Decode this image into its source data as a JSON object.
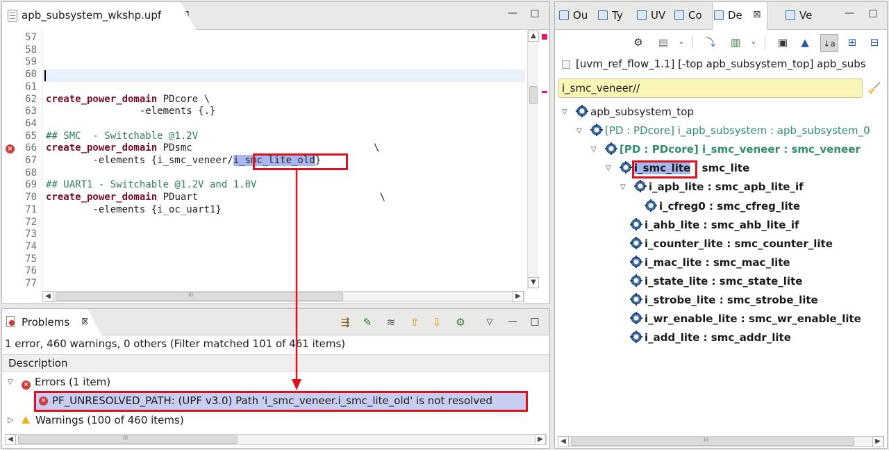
{
  "editor": {
    "tab_title": "apb_subsystem_wkshp.upf",
    "close_glyph": "⊠",
    "minimize_glyph": "—",
    "maximize_glyph": "□",
    "lines": [
      {
        "num": "57",
        "text": ""
      },
      {
        "num": "58",
        "text": ""
      },
      {
        "num": "59",
        "text": ""
      },
      {
        "num": "60",
        "text": ""
      },
      {
        "num": "61",
        "text": ""
      },
      {
        "num": "62",
        "kw": "create_power_domain",
        "rest": " PDcore \\"
      },
      {
        "num": "63",
        "text": "                -elements {.}"
      },
      {
        "num": "64",
        "text": ""
      },
      {
        "num": "65",
        "comment": "## SMC  - Switchable @1.2V"
      },
      {
        "num": "66",
        "kw": "create_power_domain",
        "rest": " PDsmc                               \\"
      },
      {
        "num": "67",
        "text": "        -elements {i_smc_veneer/",
        "highlight": "i_smc_lite_old",
        "tail": "}"
      },
      {
        "num": "68",
        "text": ""
      },
      {
        "num": "69",
        "comment": "## UART1 - Switchable @1.2V and 1.0V"
      },
      {
        "num": "70",
        "kw": "create_power_domain",
        "rest": " PDuart                               \\"
      },
      {
        "num": "71",
        "text": "        -elements {i_oc_uart1}"
      },
      {
        "num": "72",
        "text": ""
      },
      {
        "num": "73",
        "text": ""
      },
      {
        "num": "74",
        "text": ""
      },
      {
        "num": "75",
        "text": ""
      },
      {
        "num": "76",
        "text": ""
      },
      {
        "num": "77",
        "text": ""
      }
    ],
    "hscroll_grip": "III"
  },
  "problems": {
    "tab_title": "Problems",
    "summary": "1 error, 460 warnings, 0 others (Filter matched 101 of 461 items)",
    "column_header": "Description",
    "errors_group": "Errors (1 item)",
    "error_item": "PF_UNRESOLVED_PATH: (UPF v3.0) Path 'i_smc_veneer.i_smc_lite_old' is not resolved",
    "warnings_group": "Warnings (100 of 460 items)",
    "hscroll_grip": "III"
  },
  "design": {
    "tabs": [
      {
        "label": "Ou",
        "icon": "outline-icon"
      },
      {
        "label": "Ty",
        "icon": "type-hierarchy-icon"
      },
      {
        "label": "UV",
        "icon": "uvm-icon"
      },
      {
        "label": "Co",
        "icon": "components-icon"
      },
      {
        "label": "De",
        "icon": "design-icon"
      },
      {
        "label": "Ve",
        "icon": "verification-icon"
      }
    ],
    "breadcrumb": "[uvm_ref_flow_1.1] [-top apb_subsystem_top] apb_subs",
    "filter_value": "i_smc_veneer//",
    "tree": [
      {
        "indent": 0,
        "twisty": "▽",
        "label": "apb_subsystem_top",
        "style": "plain",
        "icon": "module-icon"
      },
      {
        "indent": 1,
        "twisty": "▽",
        "label": "[PD : PDcore] i_apb_subsystem : apb_subsystem_0",
        "style": "pd",
        "icon": "instance-icon"
      },
      {
        "indent": 2,
        "twisty": "▽",
        "label": "[PD : PDcore] i_smc_veneer : smc_veneer",
        "style": "pdbold",
        "icon": "instance-icon"
      },
      {
        "indent": 3,
        "twisty": "▽",
        "label": "i_smc_lite",
        "suffix": " : smc_lite",
        "style": "bold",
        "highlight": true,
        "icon": "instance-icon"
      },
      {
        "indent": 4,
        "twisty": "▽",
        "label": "i_apb_lite : smc_apb_lite_if",
        "style": "bold",
        "icon": "instance-icon"
      },
      {
        "indent": 5,
        "twisty": "",
        "label": "i_cfreg0 : smc_cfreg_lite",
        "style": "bold",
        "icon": "instance-icon"
      },
      {
        "indent": 4,
        "twisty": "",
        "label": "i_ahb_lite : smc_ahb_lite_if",
        "style": "bold",
        "icon": "instance-icon"
      },
      {
        "indent": 4,
        "twisty": "",
        "label": "i_counter_lite : smc_counter_lite",
        "style": "bold",
        "icon": "instance-icon"
      },
      {
        "indent": 4,
        "twisty": "",
        "label": "i_mac_lite : smc_mac_lite",
        "style": "bold",
        "icon": "instance-icon"
      },
      {
        "indent": 4,
        "twisty": "",
        "label": "i_state_lite : smc_state_lite",
        "style": "bold",
        "icon": "instance-icon"
      },
      {
        "indent": 4,
        "twisty": "",
        "label": "i_strobe_lite : smc_strobe_lite",
        "style": "bold",
        "icon": "instance-icon"
      },
      {
        "indent": 4,
        "twisty": "",
        "label": "i_wr_enable_lite : smc_wr_enable_lite",
        "style": "bold",
        "icon": "instance-icon"
      },
      {
        "indent": 4,
        "twisty": "",
        "label": "i_add_lite : smc_addr_lite",
        "style": "bold",
        "icon": "instance-icon"
      }
    ],
    "hscroll_grip": "III"
  },
  "colors": {
    "callout_red": "#e0101c",
    "highlight_blue": "#a9b7f0",
    "filter_yellow": "#f9f6b8",
    "pd_green": "#2f8d6a",
    "keyword": "#7a0a27",
    "comment": "#2f7d56"
  }
}
